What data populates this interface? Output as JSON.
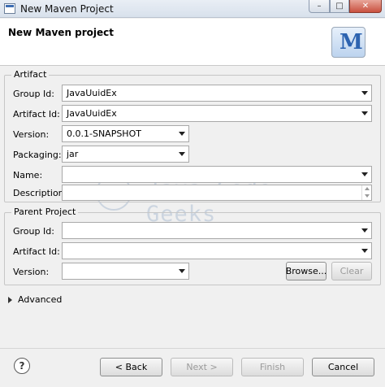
{
  "window": {
    "title": "New Maven Project"
  },
  "header": {
    "page_title": "New Maven project",
    "logo_letter": "M"
  },
  "artifact": {
    "legend": "Artifact",
    "group_id_label": "Group Id:",
    "group_id_value": "JavaUuidEx",
    "artifact_id_label": "Artifact Id:",
    "artifact_id_value": "JavaUuidEx",
    "version_label": "Version:",
    "version_value": "0.0.1-SNAPSHOT",
    "packaging_label": "Packaging:",
    "packaging_value": "jar",
    "name_label": "Name:",
    "name_value": "",
    "description_label": "Description:",
    "description_value": ""
  },
  "parent": {
    "legend": "Parent Project",
    "group_id_label": "Group Id:",
    "group_id_value": "",
    "artifact_id_label": "Artifact Id:",
    "artifact_id_value": "",
    "version_label": "Version:",
    "version_value": "",
    "browse_label": "Browse...",
    "clear_label": "Clear"
  },
  "watermark": {
    "text": "Java Code Geeks"
  },
  "advanced": {
    "label": "Advanced"
  },
  "footer": {
    "help_icon": "?",
    "back_label": "< Back",
    "next_label": "Next >",
    "finish_label": "Finish",
    "cancel_label": "Cancel"
  }
}
